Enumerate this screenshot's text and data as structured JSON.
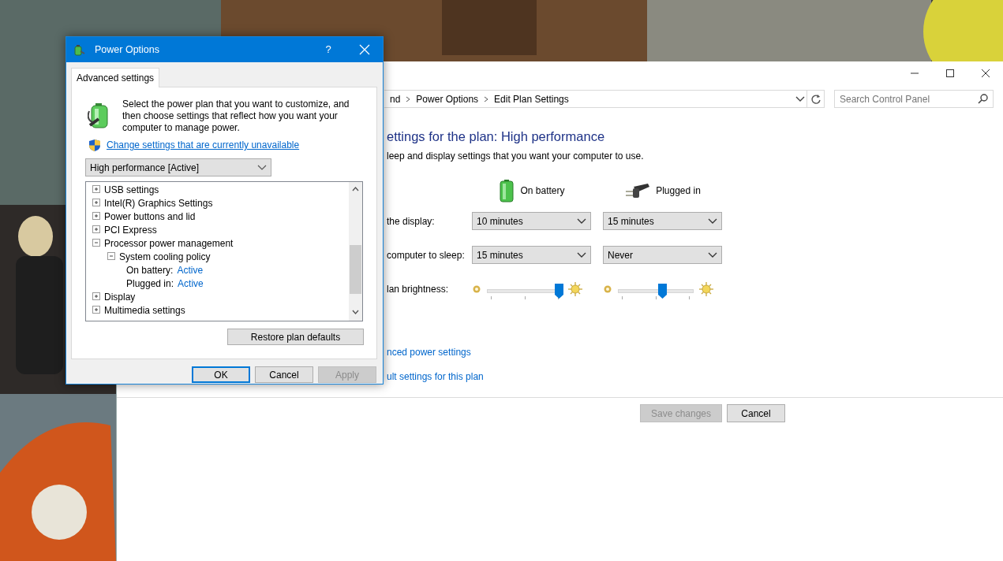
{
  "dialog": {
    "title": "Power Options",
    "help_button": "?",
    "tabs": [
      {
        "label": "Advanced settings",
        "selected": true
      }
    ],
    "description": "Select the power plan that you want to customize, and then choose settings that reflect how you want your computer to manage power.",
    "admin_link": "Change settings that are currently unavailable",
    "plan_select": {
      "value": "High performance [Active]"
    },
    "settings_tree": [
      {
        "kind": "category",
        "label": "USB settings",
        "expanded": false
      },
      {
        "kind": "category",
        "label": "Intel(R) Graphics Settings",
        "expanded": false
      },
      {
        "kind": "category",
        "label": "Power buttons and lid",
        "expanded": false
      },
      {
        "kind": "category",
        "label": "PCI Express",
        "expanded": false
      },
      {
        "kind": "category",
        "label": "Processor power management",
        "expanded": true,
        "children": [
          {
            "kind": "category",
            "label": "System cooling policy",
            "expanded": true,
            "children": [
              {
                "kind": "setting",
                "label": "On battery:",
                "value": "Active"
              },
              {
                "kind": "setting",
                "label": "Plugged in:",
                "value": "Active"
              }
            ]
          }
        ]
      },
      {
        "kind": "category",
        "label": "Display",
        "expanded": false
      },
      {
        "kind": "category",
        "label": "Multimedia settings",
        "expanded": false
      }
    ],
    "restore_button": "Restore plan defaults",
    "buttons": [
      {
        "label": "OK",
        "focused": true,
        "disabled": false
      },
      {
        "label": "Cancel",
        "focused": false,
        "disabled": false
      },
      {
        "label": "Apply",
        "focused": false,
        "disabled": true
      }
    ]
  },
  "window": {
    "breadcrumb": [
      "nd",
      "Power Options",
      "Edit Plan Settings"
    ],
    "search": {
      "placeholder": "Search Control Panel"
    },
    "heading": "ettings for the plan: High performance",
    "subheading": "leep and display settings that you want your computer to use.",
    "columns": [
      {
        "kind": "battery",
        "label": "On battery"
      },
      {
        "kind": "plug",
        "label": "Plugged in"
      }
    ],
    "settings": [
      {
        "kind": "select",
        "label": "the display:",
        "controls": [
          {
            "value": "10 minutes"
          },
          {
            "value": "15 minutes"
          }
        ]
      },
      {
        "kind": "select",
        "label": "computer to sleep:",
        "controls": [
          {
            "value": "15 minutes"
          },
          {
            "value": "Never"
          }
        ]
      },
      {
        "kind": "slider",
        "label": "lan brightness:",
        "controls": [
          {
            "level": 0.95
          },
          {
            "level": 0.58
          }
        ]
      }
    ],
    "links": [
      "nced power settings",
      "ult settings for this plan"
    ],
    "buttons": [
      {
        "label": "Save changes",
        "disabled": true
      },
      {
        "label": "Cancel",
        "disabled": false
      }
    ]
  }
}
